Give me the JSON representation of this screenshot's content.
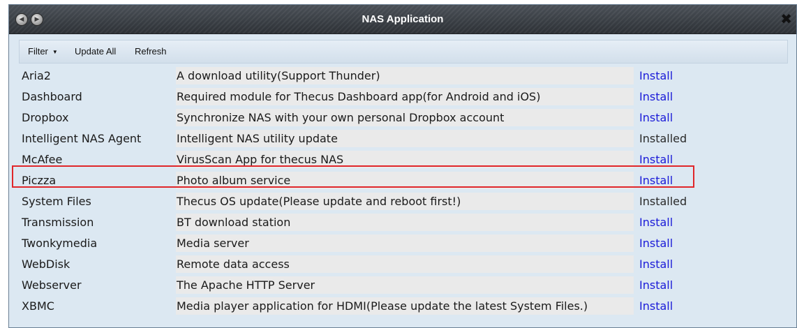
{
  "window": {
    "title": "NAS Application"
  },
  "toolbar": {
    "filter_label": "Filter",
    "update_all_label": "Update All",
    "refresh_label": "Refresh"
  },
  "apps": [
    {
      "name": "Aria2",
      "description": "A download utility(Support Thunder)",
      "action": "Install"
    },
    {
      "name": "Dashboard",
      "description": "Required module for Thecus Dashboard app(for Android and iOS)",
      "action": "Install"
    },
    {
      "name": "Dropbox",
      "description": "Synchronize NAS with your own personal Dropbox account",
      "action": "Install"
    },
    {
      "name": "Intelligent NAS Agent",
      "description": "Intelligent NAS utility update",
      "action": "Installed"
    },
    {
      "name": "McAfee",
      "description": "VirusScan App for thecus NAS",
      "action": "Install"
    },
    {
      "name": "Piczza",
      "description": "Photo album service",
      "action": "Install"
    },
    {
      "name": "System Files",
      "description": "Thecus OS update(Please update and reboot first!)",
      "action": "Installed"
    },
    {
      "name": "Transmission",
      "description": "BT download station",
      "action": "Install"
    },
    {
      "name": "Twonkymedia",
      "description": "Media server",
      "action": "Install"
    },
    {
      "name": "WebDisk",
      "description": "Remote data access",
      "action": "Install"
    },
    {
      "name": "Webserver",
      "description": "The Apache HTTP Server",
      "action": "Install"
    },
    {
      "name": "XBMC",
      "description": "Media player application for HDMI(Please update the latest System Files.)",
      "action": "Install"
    }
  ],
  "colors": {
    "install_link": "#1a1ad8",
    "highlight_border": "#e0262a",
    "titlebar": "#3a3f45"
  }
}
